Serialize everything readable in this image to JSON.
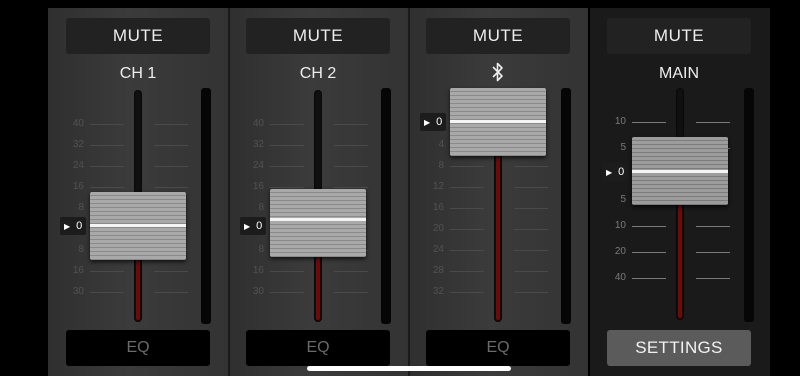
{
  "channels": [
    {
      "mute_label": "MUTE",
      "name": "CH 1",
      "bottom_label": "EQ",
      "level_label": "0",
      "scale": [
        "40",
        "32",
        "24",
        "16",
        "8",
        "0",
        "8",
        "16",
        "30"
      ]
    },
    {
      "mute_label": "MUTE",
      "name": "CH 2",
      "bottom_label": "EQ",
      "level_label": "0",
      "scale": [
        "40",
        "32",
        "24",
        "16",
        "8",
        "0",
        "8",
        "16",
        "30"
      ]
    },
    {
      "mute_label": "MUTE",
      "name_icon": "bluetooth-icon",
      "bottom_label": "EQ",
      "level_label": "0",
      "scale": [
        "0",
        "4",
        "8",
        "12",
        "16",
        "20",
        "24",
        "28",
        "32"
      ]
    }
  ],
  "main": {
    "mute_label": "MUTE",
    "name": "MAIN",
    "bottom_label": "SETTINGS",
    "level_label": "0",
    "scale": [
      "10",
      "5",
      "0",
      "5",
      "10",
      "20",
      "40"
    ]
  },
  "colors": {
    "fader_fill": "#6e0a0a",
    "strip_bg": "#333333",
    "main_bg": "#1a1a1a"
  }
}
